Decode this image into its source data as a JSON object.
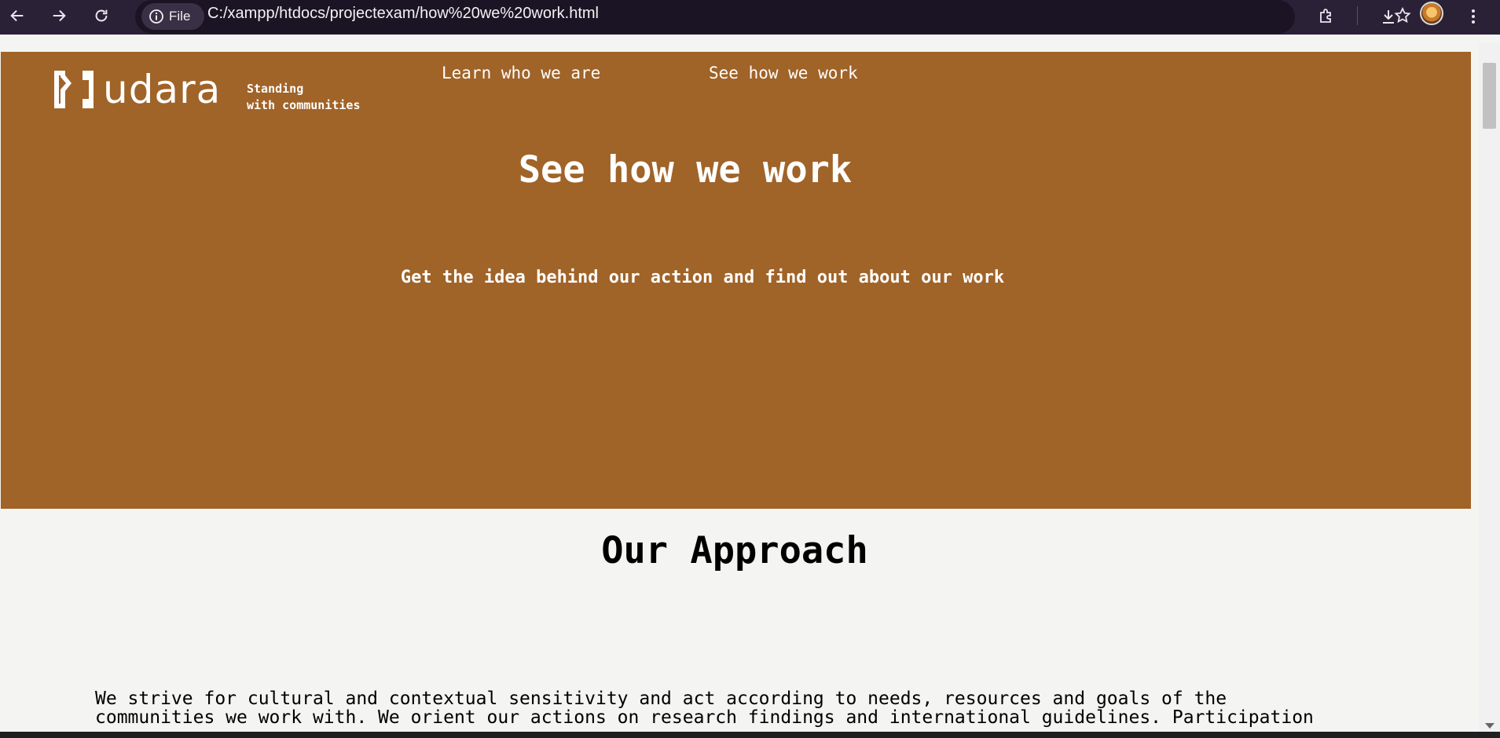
{
  "browser": {
    "site_chip_label": "File",
    "url": "C:/xampp/htdocs/projectexam/how%20we%20work.html"
  },
  "site": {
    "logo_text": "udara",
    "tagline_line1": "Standing",
    "tagline_line2": "with communities",
    "nav": [
      {
        "label": "Learn who we are"
      },
      {
        "label": "See how we work"
      }
    ]
  },
  "hero": {
    "title": "See how we work",
    "subtitle": "Get the idea behind our action and find out about our work"
  },
  "approach": {
    "title": "Our Approach",
    "text": "We strive for cultural and contextual sensitivity and act according to needs, resources and goals of the\ncommunities we work with. We orient our actions on research findings and international guidelines. Participation"
  },
  "colors": {
    "hero_background": "#a06328",
    "page_background": "#f4f4f2",
    "browser_frame": "#2b2136"
  }
}
